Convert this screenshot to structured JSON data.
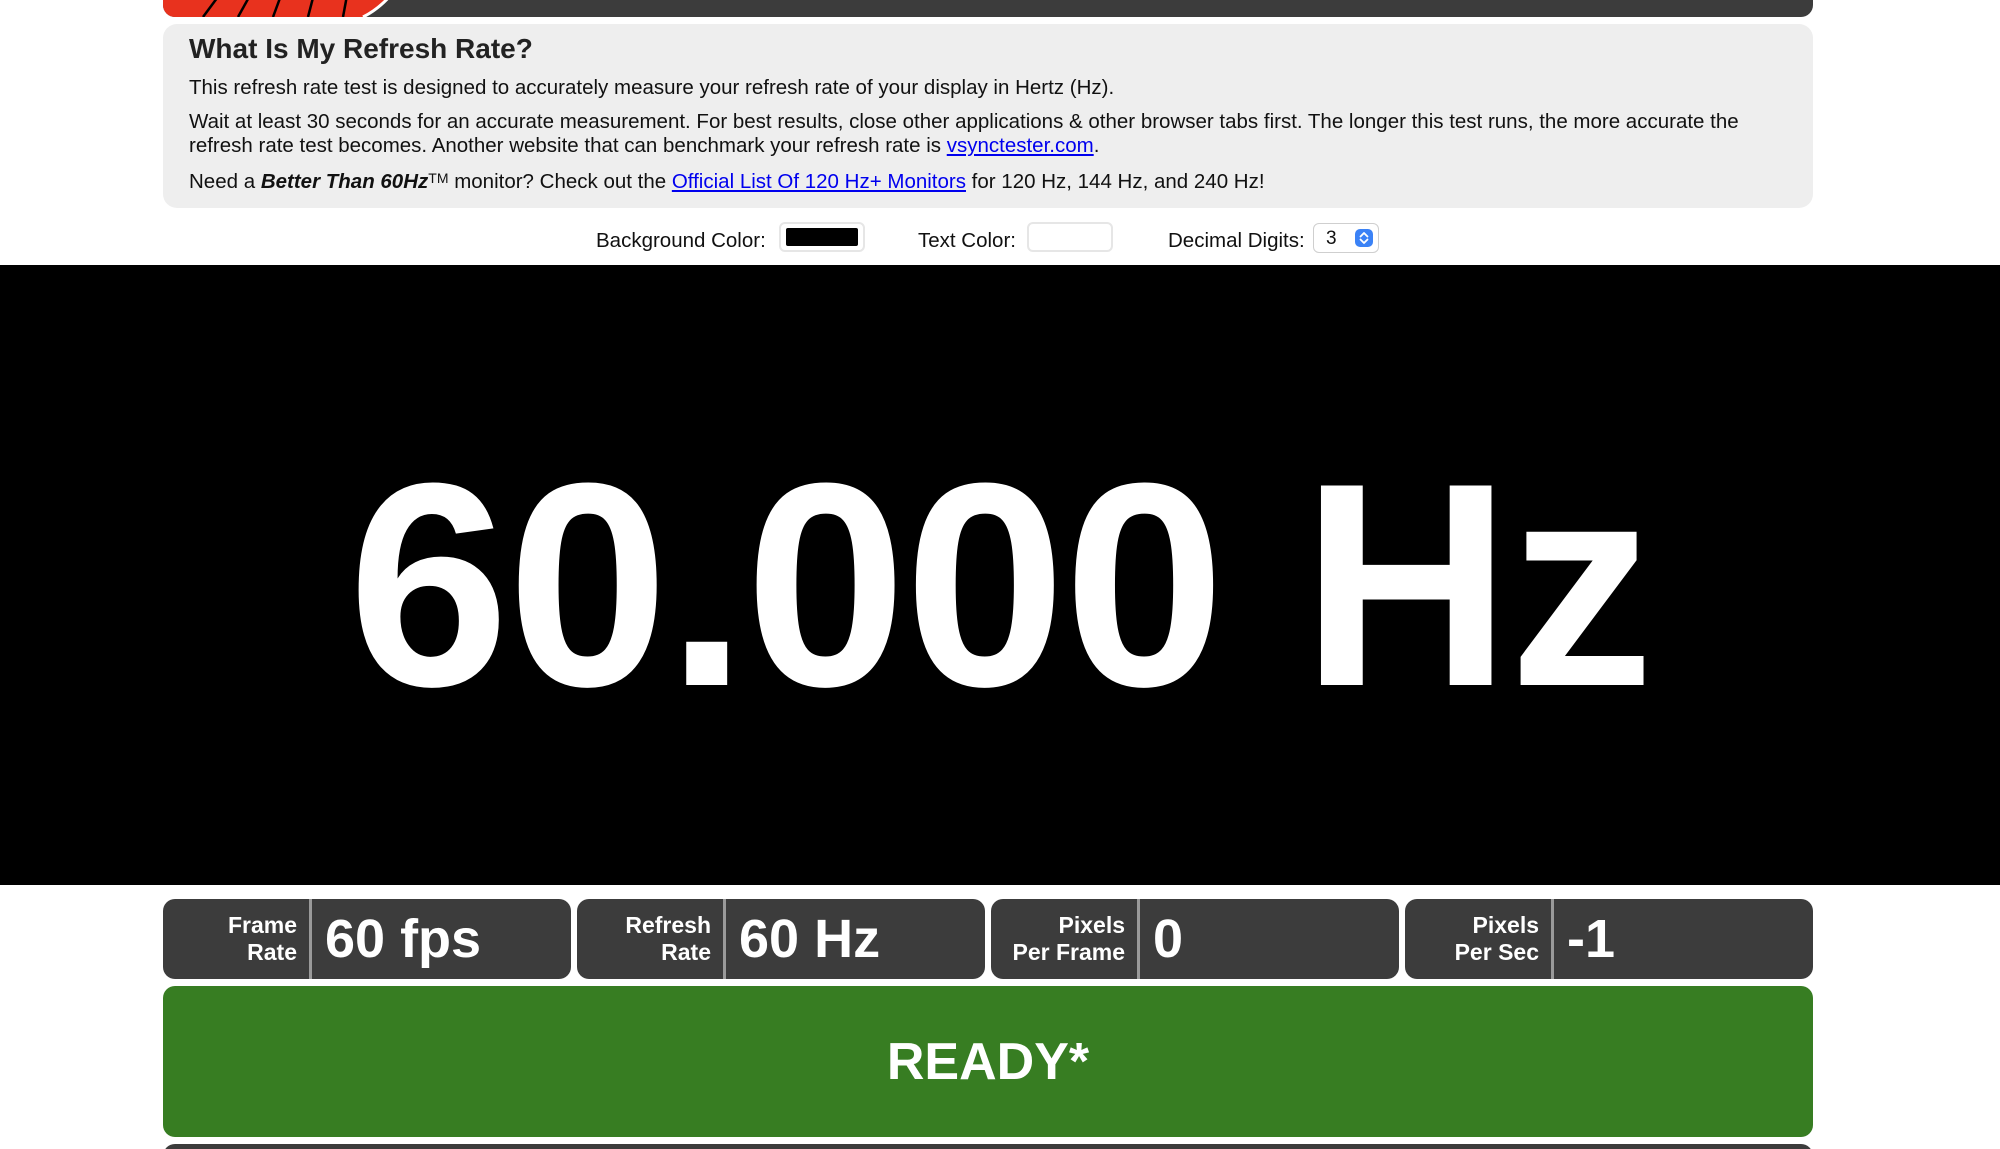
{
  "info": {
    "title": "What Is My Refresh Rate?",
    "p1": "This refresh rate test is designed to accurately measure your refresh rate of your display in Hertz (Hz).",
    "p2_text": "Wait at least 30 seconds for an accurate measurement. For best results, close other applications & other browser tabs first. The longer this test runs, the more accurate the refresh rate test becomes. Another website that can benchmark your refresh rate is ",
    "p2_link": "vsynctester.com",
    "p2_end": ".",
    "p3_pre": "Need a ",
    "p3_bold": "Better Than 60Hz",
    "p3_sup": "TM",
    "p3_mid": " monitor? Check out the ",
    "p3_link": "Official List Of 120 Hz+ Monitors",
    "p3_end": " for 120 Hz, 144 Hz, and 240 Hz!"
  },
  "controls": {
    "bg_label": "Background Color:",
    "bg_color": "#000000",
    "text_label": "Text Color:",
    "text_color": "#ffffff",
    "digits_label": "Decimal Digits:",
    "digits_value": "3"
  },
  "readout": "60.000 Hz",
  "stats": [
    {
      "label_top": "Frame",
      "label_bottom": "Rate",
      "value": "60 fps"
    },
    {
      "label_top": "Refresh",
      "label_bottom": "Rate",
      "value": "60 Hz"
    },
    {
      "label_top": "Pixels",
      "label_bottom": "Per Frame",
      "value": "0"
    },
    {
      "label_top": "Pixels",
      "label_bottom": "Per Sec",
      "value": "-1"
    }
  ],
  "status": "READY*",
  "colors": {
    "panel": "#3c3c3c",
    "ready_green": "#377d22",
    "link": "#0000ee",
    "logo_red": "#e8321e"
  }
}
